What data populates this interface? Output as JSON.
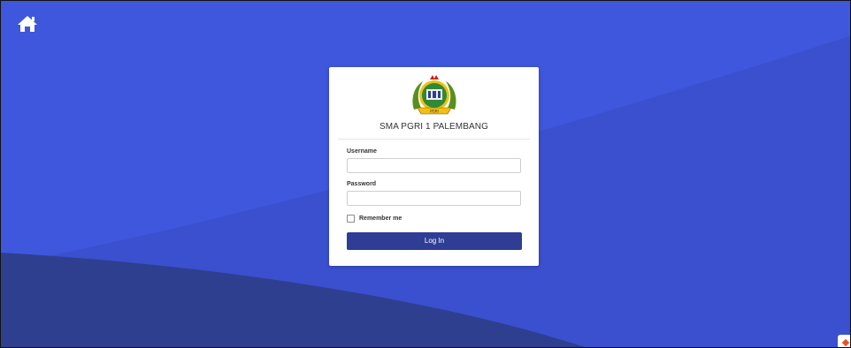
{
  "page": {
    "background_color": "#3e57dc",
    "background_wave_light": "#3a50cf",
    "background_wave_dark": "#2e3f8f"
  },
  "nav": {
    "home_icon": "home-icon"
  },
  "login_card": {
    "logo": "school-crest-logo",
    "logo_text": "PGRI",
    "school_name": "SMA PGRI 1 PALEMBANG",
    "username_label": "Username",
    "username_value": "",
    "password_label": "Password",
    "password_value": "",
    "remember_label": "Remember me",
    "remember_checked": false,
    "login_button_label": "Log In",
    "button_color": "#2f3d94"
  }
}
